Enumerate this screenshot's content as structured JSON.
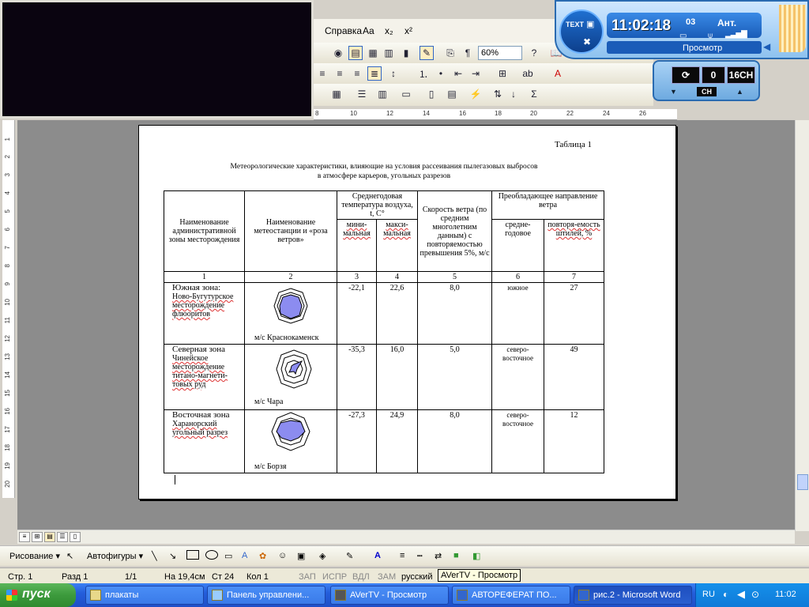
{
  "menu": {
    "spravka": "Справка",
    "zoom": "60%"
  },
  "ruler": {
    "top_ticks": [
      "8",
      "10",
      "12",
      "14",
      "16",
      "18",
      "20",
      "22",
      "24",
      "26"
    ],
    "left_ticks": [
      "1",
      "2",
      "3",
      "4",
      "5",
      "6",
      "7",
      "8",
      "9",
      "10",
      "11",
      "12",
      "13",
      "14",
      "15",
      "16",
      "17",
      "18",
      "19",
      "20"
    ]
  },
  "document": {
    "table_number": "Таблица 1",
    "caption_line1": "Метеорологические характеристики, влияющие на условия рассеивания пылегазовых выбросов",
    "caption_line2": "в атмосфере карьеров, угольных разрезов",
    "headers": {
      "h1": "Наименование административной зоны месторождения",
      "h2": "Наименование метеостанции и «роза ветров»",
      "h3": "Среднегодовая температура воздуха, t, C°",
      "h3a": "мини-мальная",
      "h3b": "макси-мальная",
      "h4": "Скорость ветра (по средним многолетним данным) с повторяемостью превышения 5%, м/с",
      "h5": "Преобладающее направление ветра",
      "h5a": "средне-годовое",
      "h5b": "повторя-емость штилей, %"
    },
    "col_numbers": [
      "1",
      "2",
      "3",
      "4",
      "5",
      "6",
      "7"
    ],
    "rows": [
      {
        "zone_title": "Южная зона:",
        "zone_body": "Ново-Бугутурское месторождение флюоритов",
        "station": "м/с Краснокаменск",
        "tmin": "-22,1",
        "tmax": "22,6",
        "wind": "8,0",
        "direction": "южное",
        "calm": "27"
      },
      {
        "zone_title": "Северная зона",
        "zone_body": "Чинейское месторождение титано-магнети-товых руд",
        "station": "м/с Чара",
        "tmin": "-35,3",
        "tmax": "16,0",
        "wind": "5,0",
        "direction": "северо-восточное",
        "calm": "49"
      },
      {
        "zone_title": "Восточная зона",
        "zone_body": "Харанорский угольный разрез",
        "station": "м/с Борзя",
        "tmin": "-27,3",
        "tmax": "24,9",
        "wind": "8,0",
        "direction": "северо-восточное",
        "calm": "12"
      }
    ]
  },
  "drawbar": {
    "draw_label": "Рисование ▾",
    "autoshapes_label": "Автофигуры ▾"
  },
  "status": {
    "page": "Стр. 1",
    "section": "Разд 1",
    "pages": "1/1",
    "at": "На 19,4см",
    "line": "Ст 24",
    "col": "Кол 1",
    "rec": "ЗАП",
    "trk": "ИСПР",
    "ext": "ВДЛ",
    "ovr": "ЗАМ",
    "lang": "русский"
  },
  "tooltip": "AVerTV - Просмотр",
  "taskbar": {
    "start": "пуск",
    "tasks": [
      "плакаты",
      "Панель управлени...",
      "AVerTV - Просмотр",
      "АВТОРЕФЕРАТ ПО...",
      "рис.2 - Microsoft Word"
    ],
    "lang": "RU",
    "time": "11:02"
  },
  "avertv": {
    "time": "11:02:18",
    "channel": "03",
    "antenna": "Ант.",
    "mode": "Просмотр",
    "text_btn": "TEXT",
    "display_zero": "0",
    "display_16ch": "16CH",
    "ch_label": "CH"
  },
  "colors": {
    "taskbar": "#245edb",
    "start": "#3c9a3c",
    "doc_bg": "#8c8c8c",
    "rose_fill": "#8c8cf0"
  }
}
